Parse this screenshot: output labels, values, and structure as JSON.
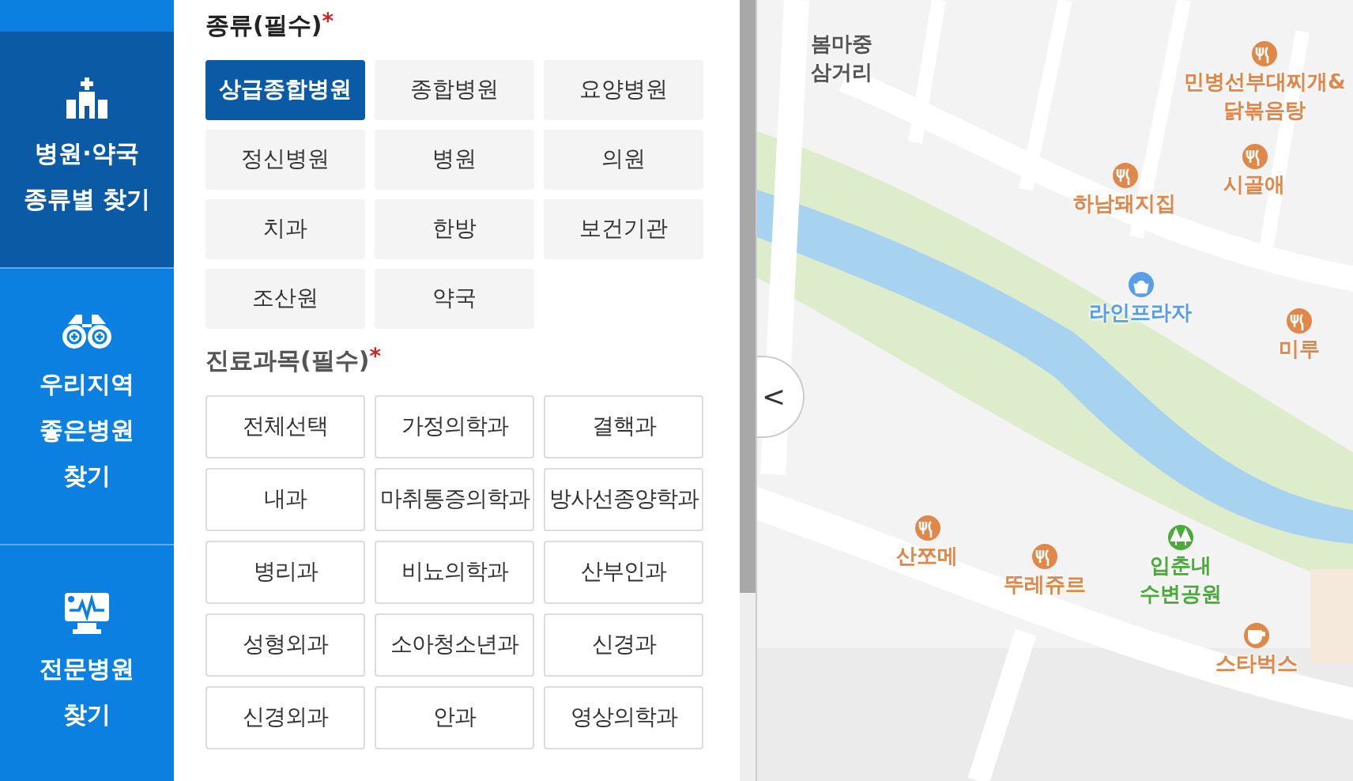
{
  "sidebar": {
    "items": [
      {
        "kind": "hospital",
        "lines": [
          "병원·약국",
          "종류별 찾기"
        ],
        "selected": true
      },
      {
        "kind": "binoculars",
        "lines": [
          "우리지역",
          "좋은병원",
          "찾기"
        ],
        "selected": false
      },
      {
        "kind": "monitor",
        "lines": [
          "전문병원",
          "찾기"
        ],
        "selected": false
      }
    ]
  },
  "type_section": {
    "title": "종류(필수)",
    "required_mark": "*",
    "options": [
      {
        "label": "상급종합병원",
        "selected": true
      },
      {
        "label": "종합병원",
        "selected": false
      },
      {
        "label": "요양병원",
        "selected": false
      },
      {
        "label": "정신병원",
        "selected": false
      },
      {
        "label": "병원",
        "selected": false
      },
      {
        "label": "의원",
        "selected": false
      },
      {
        "label": "치과",
        "selected": false
      },
      {
        "label": "한방",
        "selected": false
      },
      {
        "label": "보건기관",
        "selected": false
      },
      {
        "label": "조산원",
        "selected": false
      },
      {
        "label": "약국",
        "selected": false
      }
    ]
  },
  "department_section": {
    "title": "진료과목(필수)",
    "required_mark": "*",
    "options": [
      {
        "label": "전체선택",
        "selected": false
      },
      {
        "label": "가정의학과",
        "selected": false
      },
      {
        "label": "결핵과",
        "selected": false
      },
      {
        "label": "내과",
        "selected": false
      },
      {
        "label": "마취통증의학과",
        "selected": false
      },
      {
        "label": "방사선종양학과",
        "selected": false
      },
      {
        "label": "병리과",
        "selected": false
      },
      {
        "label": "비뇨의학과",
        "selected": false
      },
      {
        "label": "산부인과",
        "selected": false
      },
      {
        "label": "성형외과",
        "selected": false
      },
      {
        "label": "소아청소년과",
        "selected": false
      },
      {
        "label": "신경과",
        "selected": false
      },
      {
        "label": "신경외과",
        "selected": false
      },
      {
        "label": "안과",
        "selected": false
      },
      {
        "label": "영상의학과",
        "selected": false
      }
    ]
  },
  "map": {
    "collapse_button": "<",
    "places": [
      {
        "kind": "junction",
        "lines": [
          "봄마중",
          "삼거리"
        ]
      },
      {
        "kind": "restaurant",
        "lines": [
          "민병선부대찌개&",
          "닭볶음탕"
        ]
      },
      {
        "kind": "restaurant",
        "lines": [
          "하남돼지집"
        ]
      },
      {
        "kind": "restaurant",
        "lines": [
          "시골애"
        ]
      },
      {
        "kind": "shopping",
        "lines": [
          "라인프라자"
        ]
      },
      {
        "kind": "restaurant",
        "lines": [
          "미루"
        ]
      },
      {
        "kind": "restaurant",
        "lines": [
          "산쪼메"
        ]
      },
      {
        "kind": "restaurant",
        "lines": [
          "뚜레쥬르"
        ]
      },
      {
        "kind": "park",
        "lines": [
          "입춘내",
          "수변공원"
        ]
      },
      {
        "kind": "cafe",
        "lines": [
          "스타벅스"
        ]
      }
    ]
  }
}
